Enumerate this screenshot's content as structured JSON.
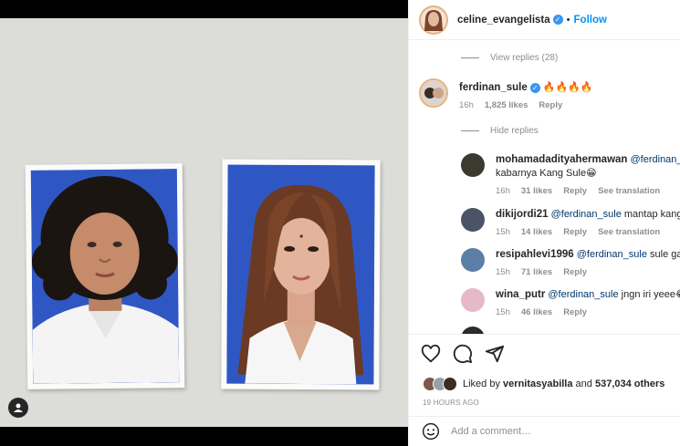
{
  "post": {
    "author": "celine_evangelista",
    "separator": "•",
    "follow_label": "Follow",
    "verified_mark": "✓"
  },
  "comments": {
    "view_replies": "View replies (28)",
    "main": {
      "username": "ferdinan_sule",
      "text": "🔥🔥🔥🔥",
      "time": "16h",
      "likes": "1,825 likes",
      "reply": "Reply"
    },
    "hide_replies": "Hide replies",
    "replies": [
      {
        "username": "mohamadadityahermawan",
        "mention": "@ferdinan_sule",
        "line2": "kabarnya Kang Sule😁",
        "time": "16h",
        "likes": "31 likes",
        "reply": "Reply",
        "translate": "See translation",
        "avatar_color": "#3a3a2e"
      },
      {
        "username": "dikijordi21",
        "mention": "@ferdinan_sule",
        "text": "mantap kang",
        "time": "15h",
        "likes": "14 likes",
        "reply": "Reply",
        "translate": "See translation",
        "avatar_color": "#4a5466"
      },
      {
        "username": "resipahlevi1996",
        "mention": "@ferdinan_sule",
        "text": "sule ga d",
        "time": "15h",
        "likes": "71 likes",
        "reply": "Reply",
        "avatar_color": "#5b7fa6"
      },
      {
        "username": "wina_putr",
        "mention": "@ferdinan_sule",
        "text": "jngn iri yeee😂",
        "time": "15h",
        "likes": "46 likes",
        "reply": "Reply",
        "avatar_color": "#e6b9c9"
      }
    ]
  },
  "actions": {
    "like_icon": "heart-icon",
    "comment_icon": "comment-icon",
    "share_icon": "share-icon"
  },
  "likes": {
    "prefix": "Liked by",
    "user": "vernitasyabilla",
    "and": "and",
    "others": "537,034 others"
  },
  "timestamp": "19 HOURS AGO",
  "add_comment": {
    "placeholder": "Add a comment…",
    "emoji_icon": "smiley-icon"
  },
  "colors": {
    "accent": "#0095f6",
    "verified": "#3897f0",
    "muted": "#8e8e8e",
    "photo_blue": "#2f57c4"
  }
}
